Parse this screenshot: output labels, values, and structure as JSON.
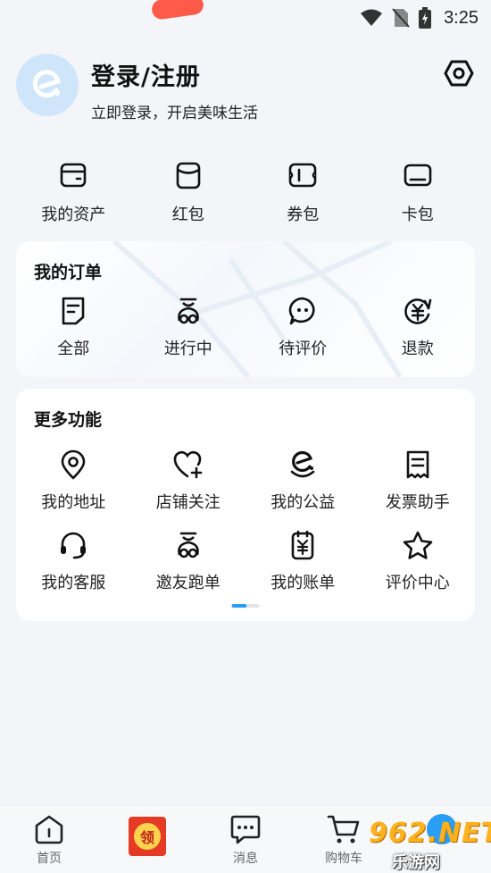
{
  "status_bar": {
    "time": "3:25"
  },
  "profile": {
    "title": "登录/注册",
    "subtitle": "立即登录，开启美味生活"
  },
  "wallet": [
    {
      "label": "我的资产",
      "icon": "wallet-icon"
    },
    {
      "label": "红包",
      "icon": "red-packet-icon"
    },
    {
      "label": "券包",
      "icon": "coupon-icon"
    },
    {
      "label": "卡包",
      "icon": "card-icon"
    }
  ],
  "orders": {
    "title": "我的订单",
    "items": [
      {
        "label": "全部",
        "icon": "document-icon"
      },
      {
        "label": "进行中",
        "icon": "scooter-icon"
      },
      {
        "label": "待评价",
        "icon": "chat-bubble-icon"
      },
      {
        "label": "退款",
        "icon": "refund-icon"
      }
    ]
  },
  "more": {
    "title": "更多功能",
    "row1": [
      {
        "label": "我的地址",
        "icon": "location-icon"
      },
      {
        "label": "店铺关注",
        "icon": "heart-plus-icon"
      },
      {
        "label": "我的公益",
        "icon": "charity-icon"
      },
      {
        "label": "发票助手",
        "icon": "receipt-icon"
      }
    ],
    "row2": [
      {
        "label": "我的客服",
        "icon": "headset-icon"
      },
      {
        "label": "邀友跑单",
        "icon": "scooter-icon"
      },
      {
        "label": "我的账单",
        "icon": "bill-icon"
      },
      {
        "label": "评价中心",
        "icon": "star-icon"
      }
    ],
    "pager": {
      "pages": 2,
      "active": 1
    }
  },
  "bottom_nav": [
    {
      "label": "首页",
      "icon": "home-icon"
    },
    {
      "label": "",
      "icon": "red-packet-coin-icon",
      "coin_text": "领"
    },
    {
      "label": "消息",
      "icon": "message-icon"
    },
    {
      "label": "购物车",
      "icon": "cart-icon"
    },
    {
      "label": "",
      "icon": "profile-icon"
    }
  ],
  "watermark": {
    "top": "962.NET",
    "bottom": "乐游网"
  },
  "colors": {
    "accent": "#2a9df4",
    "avatar_bg": "#cfe6fa",
    "red": "#e53a24"
  }
}
